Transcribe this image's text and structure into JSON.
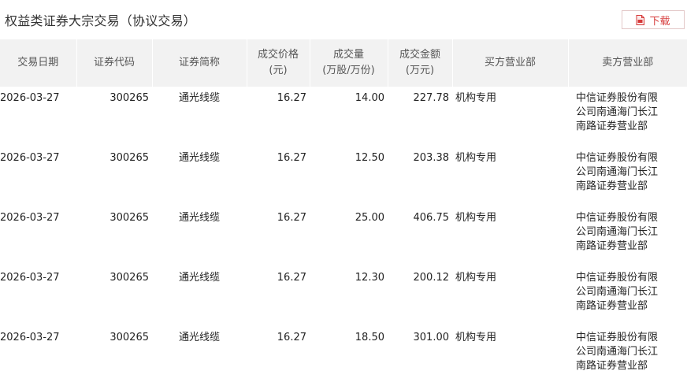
{
  "header": {
    "title": "权益类证券大宗交易（协议交易）",
    "download_label": "下载",
    "download_icon": "download-doc-icon",
    "accent_color": "#d63a3a"
  },
  "table": {
    "columns": [
      {
        "key": "date",
        "label": "交易日期"
      },
      {
        "key": "code",
        "label": "证券代码"
      },
      {
        "key": "name",
        "label": "证券简称"
      },
      {
        "key": "price",
        "label": "成交价格\n(元)"
      },
      {
        "key": "volume",
        "label": "成交量\n(万股/万份)"
      },
      {
        "key": "amount",
        "label": "成交金额\n(万元)"
      },
      {
        "key": "buyer",
        "label": "买方营业部"
      },
      {
        "key": "seller",
        "label": "卖方营业部"
      }
    ],
    "rows": [
      {
        "date": "2026-03-27",
        "code": "300265",
        "name": "通光线缆",
        "price": "16.27",
        "volume": "14.00",
        "amount": "227.78",
        "buyer": "机构专用",
        "seller": "中信证券股份有限公司南通海门长江南路证券营业部"
      },
      {
        "date": "2026-03-27",
        "code": "300265",
        "name": "通光线缆",
        "price": "16.27",
        "volume": "12.50",
        "amount": "203.38",
        "buyer": "机构专用",
        "seller": "中信证券股份有限公司南通海门长江南路证券营业部"
      },
      {
        "date": "2026-03-27",
        "code": "300265",
        "name": "通光线缆",
        "price": "16.27",
        "volume": "25.00",
        "amount": "406.75",
        "buyer": "机构专用",
        "seller": "中信证券股份有限公司南通海门长江南路证券营业部"
      },
      {
        "date": "2026-03-27",
        "code": "300265",
        "name": "通光线缆",
        "price": "16.27",
        "volume": "12.30",
        "amount": "200.12",
        "buyer": "机构专用",
        "seller": "中信证券股份有限公司南通海门长江南路证券营业部"
      },
      {
        "date": "2026-03-27",
        "code": "300265",
        "name": "通光线缆",
        "price": "16.27",
        "volume": "18.50",
        "amount": "301.00",
        "buyer": "机构专用",
        "seller": "中信证券股份有限公司南通海门长江南路证券营业部"
      }
    ]
  }
}
